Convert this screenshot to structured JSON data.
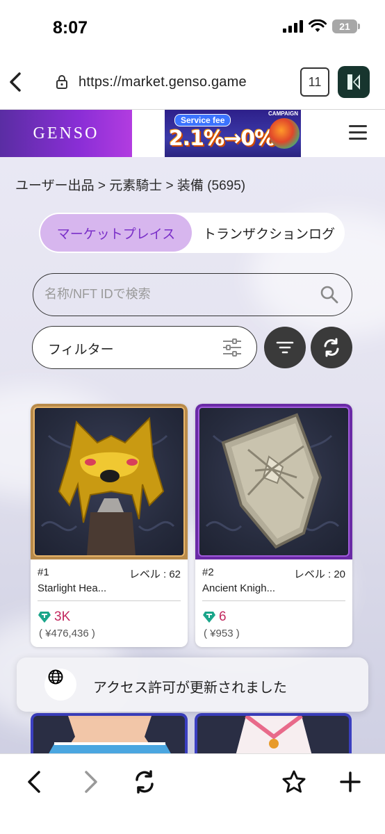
{
  "status_bar": {
    "time": "8:07",
    "battery": "21"
  },
  "browser": {
    "url": "https://market.genso.game",
    "tab_count": "11"
  },
  "header": {
    "logo": "GENSO",
    "banner": {
      "campaign": "CAMPAIGN",
      "service_fee": "Service fee",
      "headline": "2.1%→0%"
    }
  },
  "breadcrumb": "ユーザー出品 > 元素騎士 > 装備 (5695)",
  "tabs": [
    {
      "label": "マーケットプレイス",
      "active": true
    },
    {
      "label": "トランザクションログ",
      "active": false
    }
  ],
  "search": {
    "placeholder": "名称/NFT IDで検索"
  },
  "filter": {
    "label": "フィルター"
  },
  "cards": [
    {
      "number": "#1",
      "level": "レベル : 62",
      "name": "Starlight Hea...",
      "price": "3K",
      "yen": "( ¥476,436 )"
    },
    {
      "number": "#2",
      "level": "レベル : 20",
      "name": "Ancient Knigh...",
      "price": "6",
      "yen": "( ¥953 )"
    }
  ],
  "toast": {
    "message": "アクセス許可が更新されました"
  },
  "colors": {
    "accent": "#7a2fc8",
    "segment_active_bg": "#d7b6ee",
    "price": "#c2285e",
    "gem": "#1aa58a"
  }
}
